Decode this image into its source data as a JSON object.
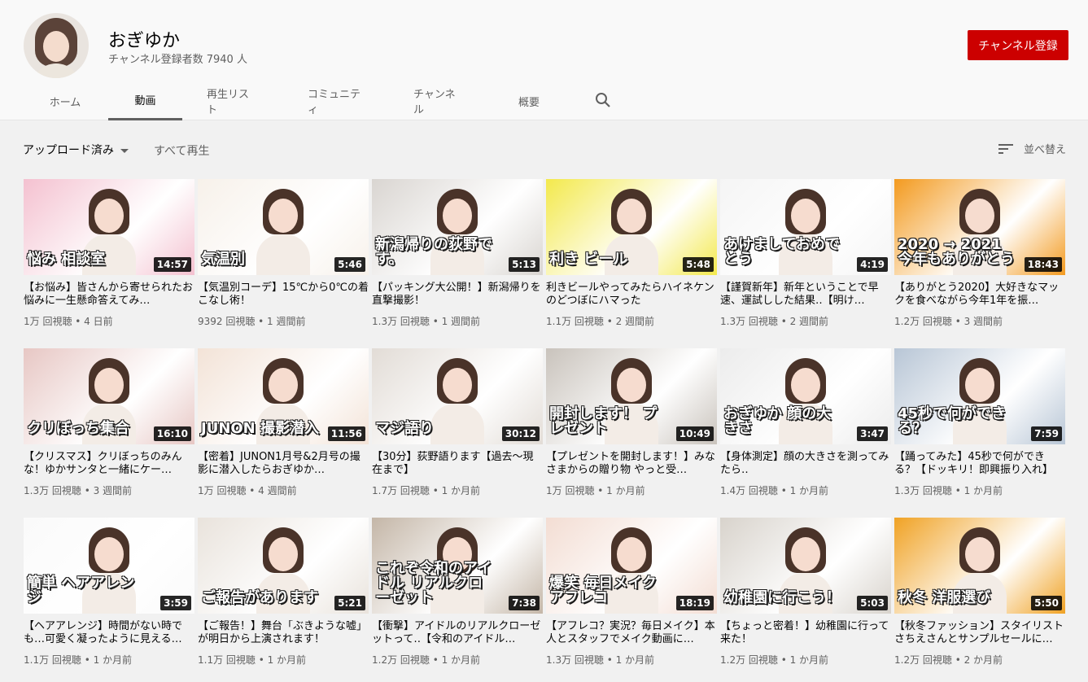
{
  "channel": {
    "name": "おぎゆか",
    "subscribers": "チャンネル登録者数 7940 人",
    "subscribe_label": "チャンネル登録"
  },
  "tabs": [
    "ホーム",
    "動画",
    "再生リスト",
    "コミュニティ",
    "チャンネル",
    "概要"
  ],
  "active_tab": "動画",
  "filter": {
    "uploaded_label": "アップロード済み",
    "play_all_label": "すべて再生",
    "sort_label": "並べ替え"
  },
  "videos": [
    {
      "title": "【お悩み】皆さんから寄せられたお悩みに一生懸命答えてみ…",
      "meta": "1万 回視聴 • 4 日前",
      "duration": "14:57",
      "overlay": "悩み 相談室",
      "color": "#f4c1d0"
    },
    {
      "title": "【気温別コーデ】15℃から0℃の着こなし術！",
      "meta": "9392 回視聴 • 1 週間前",
      "duration": "5:46",
      "overlay": "気温別",
      "color": "#f7f1ea"
    },
    {
      "title": "【パッキング大公開！】新潟帰りを直撃撮影！",
      "meta": "1.3万 回視聴 • 1 週間前",
      "duration": "5:13",
      "overlay": "新潟帰りの荻野です。",
      "color": "#d9d5d1"
    },
    {
      "title": "利きビールやってみたらハイネケンのどつぼにハマった",
      "meta": "1.1万 回視聴 • 2 週間前",
      "duration": "5:48",
      "overlay": "利き ビール",
      "color": "#f3e94c"
    },
    {
      "title": "【謹賀新年】新年ということで早速、運試しした結果‥【明け…",
      "meta": "1.3万 回視聴 • 2 週間前",
      "duration": "4:19",
      "overlay": "あけましておめでとう",
      "color": "#f5f5f5"
    },
    {
      "title": "【ありがとう2020】大好きなマックを食べながら今年1年を振…",
      "meta": "1.2万 回視聴 • 3 週間前",
      "duration": "18:43",
      "overlay": "2020 → 2021 今年もありがとう",
      "color": "#f39a1f"
    },
    {
      "title": "【クリスマス】クリぼっちのみんな！ゆかサンタと一緒にケー…",
      "meta": "1.3万 回視聴 • 3 週間前",
      "duration": "16:10",
      "overlay": "クリぼっち集合",
      "color": "#e7c7c4"
    },
    {
      "title": "【密着】JUNON1月号&2月号の撮影に潜入したらおぎゆか…",
      "meta": "1万 回視聴 • 4 週間前",
      "duration": "11:56",
      "overlay": "JUNON 撮影潜入",
      "color": "#f3e3d7"
    },
    {
      "title": "【30分】荻野語ります【過去〜現在まで】",
      "meta": "1.7万 回視聴 • 1 か月前",
      "duration": "30:12",
      "overlay": "マジ語り",
      "color": "#e2dcd6"
    },
    {
      "title": "【プレゼントを開封します！】みなさまからの贈り物 やっと受…",
      "meta": "1万 回視聴 • 1 か月前",
      "duration": "10:49",
      "overlay": "開封します！ プレゼント",
      "color": "#c9c3bc"
    },
    {
      "title": "【身体測定】顔の大きさを測ってみたら‥",
      "meta": "1.4万 回視聴 • 1 か月前",
      "duration": "3:47",
      "overlay": "おぎゆか 顔の大きさ",
      "color": "#ececec"
    },
    {
      "title": "【踊ってみた】45秒で何ができる？【ドッキリ！即興振り入れ】",
      "meta": "1.3万 回視聴 • 1 か月前",
      "duration": "7:59",
      "overlay": "45秒で何ができる？",
      "color": "#b8c6d6"
    },
    {
      "title": "【ヘアアレンジ】時間がない時でも…可愛く凝ったように見える…",
      "meta": "1.1万 回視聴 • 1 か月前",
      "duration": "3:59",
      "overlay": "簡単 ヘアアレンジ",
      "color": "#fafafa"
    },
    {
      "title": "【ご報告！】舞台「ぶきような嘘」が明日から上演されます！",
      "meta": "1.1万 回視聴 • 1 か月前",
      "duration": "5:21",
      "overlay": "ご報告があります",
      "color": "#e9e3dc"
    },
    {
      "title": "【衝撃】アイドルのリアルクローゼットって‥【令和のアイドル…",
      "meta": "1.2万 回視聴 • 1 か月前",
      "duration": "7:38",
      "overlay": "これぞ令和のアイドル リアルクローゼット",
      "color": "#c4b6a7"
    },
    {
      "title": "【アフレコ？実況？毎日メイク】本人とスタッフでメイク動画に…",
      "meta": "1.3万 回視聴 • 1 か月前",
      "duration": "18:19",
      "overlay": "爆笑 毎日メイク アフレコ",
      "color": "#f3ddd3"
    },
    {
      "title": "【ちょっと密着！】幼稚園に行って来た！",
      "meta": "1.2万 回視聴 • 1 か月前",
      "duration": "5:03",
      "overlay": "幼稚園に行こう！",
      "color": "#d8d3cc"
    },
    {
      "title": "【秋冬ファッション】スタイリストさちえさんとサンプルセールに…",
      "meta": "1.2万 回視聴 • 2 か月前",
      "duration": "5:50",
      "overlay": "秋冬 洋服選び",
      "color": "#f0a224"
    }
  ]
}
